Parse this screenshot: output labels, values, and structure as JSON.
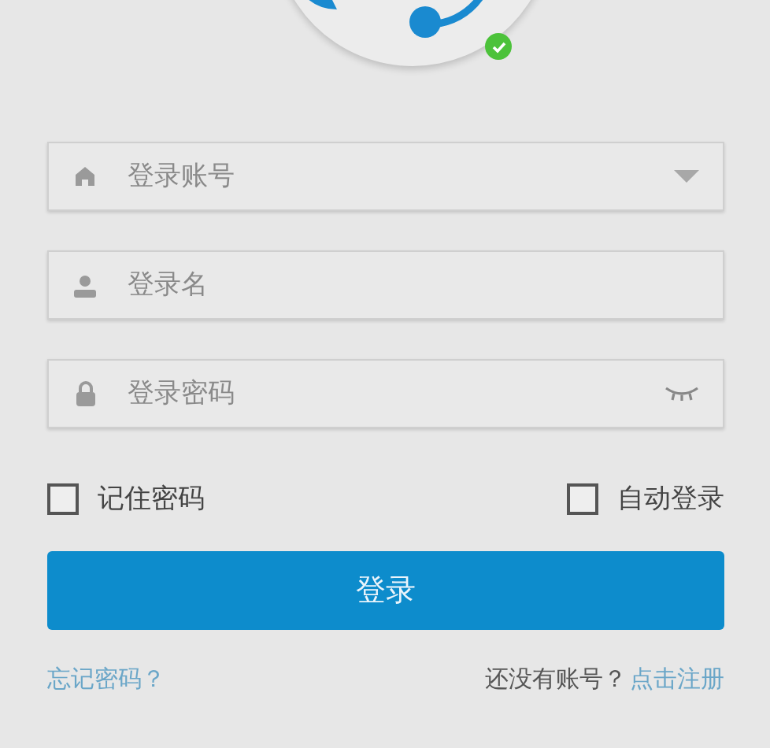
{
  "avatar": {
    "online": true
  },
  "fields": [
    {
      "kind": "account",
      "placeholder": "登录账号"
    },
    {
      "kind": "name",
      "placeholder": "登录名"
    },
    {
      "kind": "password",
      "placeholder": "登录密码"
    }
  ],
  "checkboxes": [
    {
      "label": "记住密码",
      "checked": false
    },
    {
      "label": "自动登录",
      "checked": false
    }
  ],
  "login_button": "登录",
  "forgot_link": "忘记密码？",
  "register_prompt": "还没有账号？",
  "register_link": "点击注册"
}
